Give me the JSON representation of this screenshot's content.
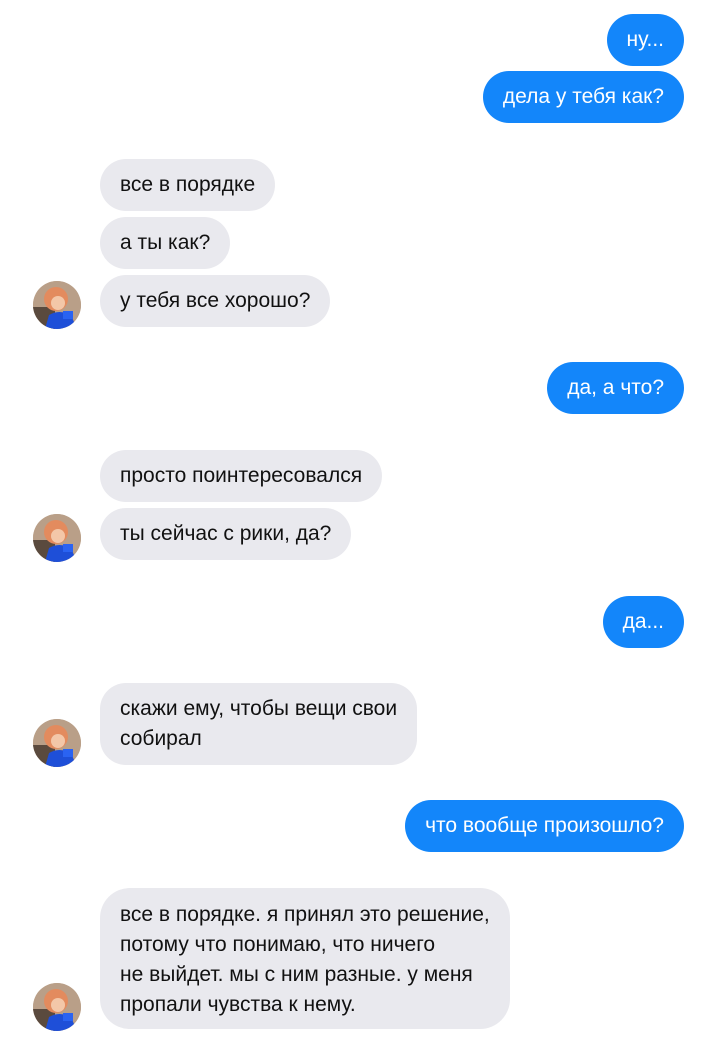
{
  "conversation": {
    "messages": [
      {
        "text": "ну...",
        "from": "me"
      },
      {
        "text": "дела у тебя как?",
        "from": "me"
      },
      {
        "text": "все в порядке",
        "from": "them"
      },
      {
        "text": "а ты как?",
        "from": "them"
      },
      {
        "text": "у тебя все хорошо?",
        "from": "them"
      },
      {
        "text": "да, а что?",
        "from": "me"
      },
      {
        "text": "просто поинтересовался",
        "from": "them"
      },
      {
        "text": "ты сейчас с рики, да?",
        "from": "them"
      },
      {
        "text": "да...",
        "from": "me"
      },
      {
        "text": "скажи ему, чтобы вещи свои\nсобирал",
        "from": "them"
      },
      {
        "text": "что вообще произошло?",
        "from": "me"
      },
      {
        "text": "все в порядке. я принял это решение,\nпотому что понимаю, что ничего\nне выйдет. мы с ним разные. у меня\nпропали чувства к нему.",
        "from": "them"
      }
    ]
  },
  "colors": {
    "outgoing_bubble": "#1386fa",
    "incoming_bubble": "#e9e9ee",
    "background": "#ffffff"
  },
  "icons": {
    "contact_avatar": "avatar-photo-red-hair-blue-shirt"
  }
}
